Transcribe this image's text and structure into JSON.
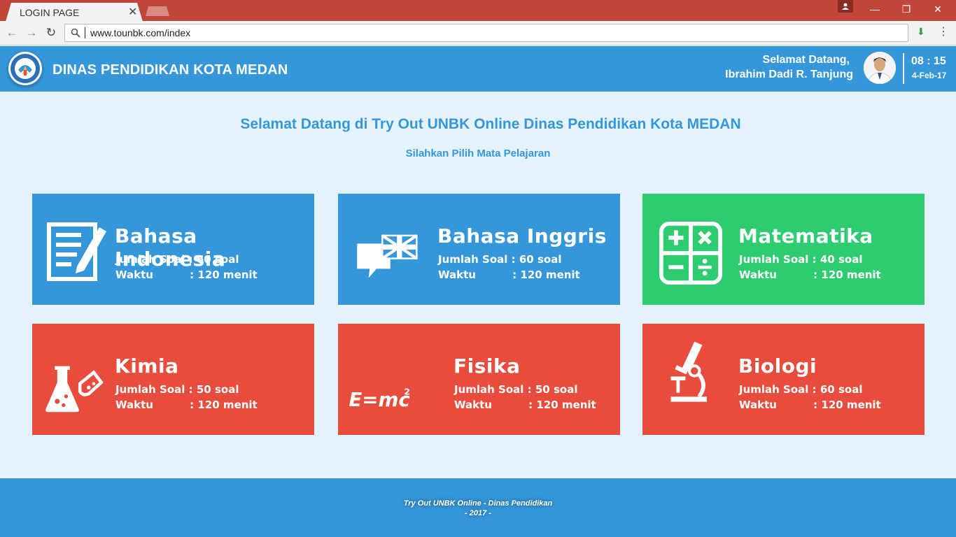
{
  "browser": {
    "tab_title": "LOGIN PAGE",
    "tab_close": "✕",
    "url": "www.tounbk.com/index",
    "window_controls": {
      "minimize": "—",
      "restore": "❐",
      "close": "✕"
    }
  },
  "header": {
    "site_title": "DINAS PENDIDIKAN KOTA MEDAN",
    "greeting": "Selamat Datang,",
    "user_name": "Ibrahim Dadi R. Tanjung",
    "time": "08 : 15",
    "date": "4-Feb-17"
  },
  "main": {
    "heading": "Selamat Datang di Try Out UNBK Online Dinas Pendidikan Kota MEDAN",
    "subheading": "Silahkan Pilih Mata Pelajaran"
  },
  "subjects": [
    {
      "name": "Bahasa Indonesia",
      "soal": "Jumlah Soal : 60 soal",
      "waktu": "Waktu          : 120 menit",
      "color": "#3597da",
      "icon": "document-pencil-icon"
    },
    {
      "name": "Bahasa Inggris",
      "soal": "Jumlah Soal : 60 soal",
      "waktu": "Waktu          : 120 menit",
      "color": "#3597da",
      "icon": "speech-bubble-flag-icon"
    },
    {
      "name": "Matematika",
      "soal": "Jumlah Soal : 40 soal",
      "waktu": "Waktu          : 120 menit",
      "color": "#2ecc71",
      "icon": "calculator-operators-icon"
    },
    {
      "name": "Kimia",
      "soal": "Jumlah Soal : 50 soal",
      "waktu": "Waktu          : 120 menit",
      "color": "#e74c3c",
      "icon": "chemistry-flask-icon"
    },
    {
      "name": "Fisika",
      "soal": "Jumlah Soal : 50 soal",
      "waktu": "Waktu          : 120 menit",
      "color": "#e74c3c",
      "icon": "emc2-formula-icon"
    },
    {
      "name": "Biologi",
      "soal": "Jumlah Soal : 60 soal",
      "waktu": "Waktu          : 120 menit",
      "color": "#e74c3c",
      "icon": "microscope-icon"
    }
  ],
  "footer": {
    "line1": "Try Out UNBK Online - Dinas Pendidikan",
    "line2": "- 2017 -"
  }
}
